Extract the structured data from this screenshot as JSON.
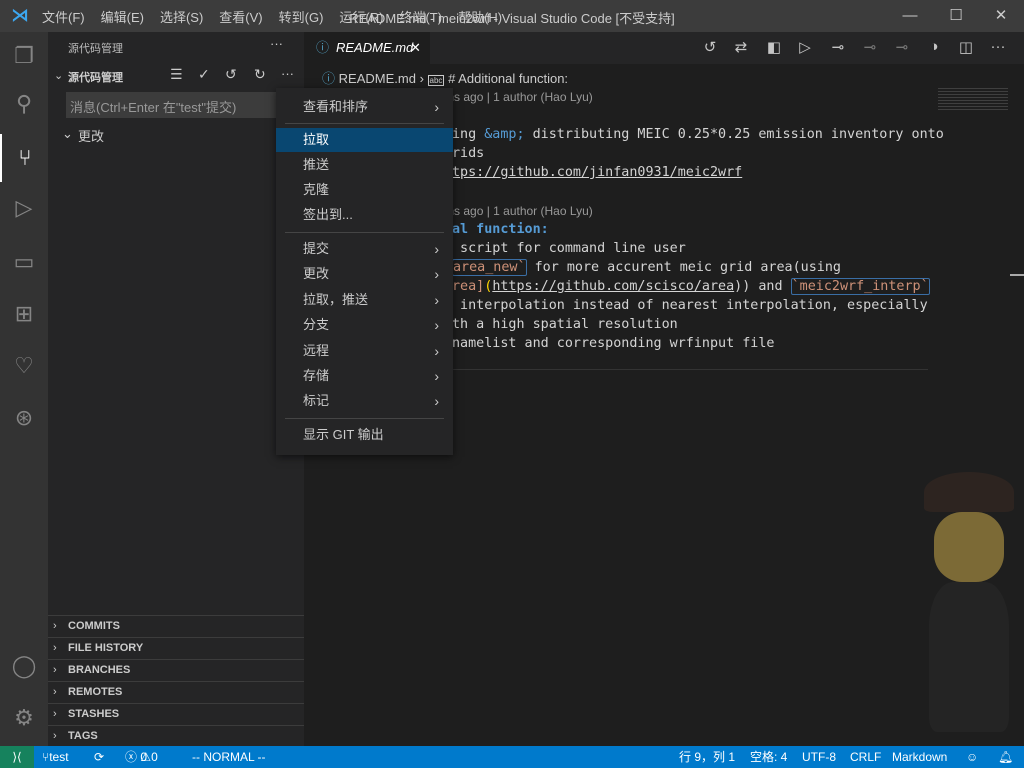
{
  "titlebar": {
    "title": "README.md - meic2wrf - Visual Studio Code [不受支持]",
    "menu": [
      "文件(F)",
      "编辑(E)",
      "选择(S)",
      "查看(V)",
      "转到(G)",
      "运行(R)",
      "终端(T)",
      "帮助(H)"
    ]
  },
  "sidebar": {
    "header": "源代码管理",
    "section_title": "源代码管理",
    "commit_placeholder": "消息(Ctrl+Enter 在\"test\"提交)",
    "changes": "更改",
    "panes": [
      "COMMITS",
      "FILE HISTORY",
      "BRANCHES",
      "REMOTES",
      "STASHES",
      "TAGS"
    ]
  },
  "editor": {
    "tab": "README.md",
    "breadcrumb": {
      "file": "README.md",
      "symbol": "# Additional function:"
    },
    "codelens": [
      "ths ago | 1 author (Hao Lyu)",
      "ths ago | 1 author (Hao Lyu)"
    ],
    "lines": {
      "l1a": "ing ",
      "l1b": "&amp;",
      "l1c": " distributing MEIC 0.25*0.25 emission inventory onto",
      "l2": "rids",
      "l3": "tps://github.com/jinfan0931/meic2wrf",
      "l4": "al function:",
      "l5": " script for command line user",
      "l6a": "area_new`",
      "l6b": " for more accurent meic grid area(using",
      "l7a": "rea]",
      "l7b": "(",
      "l7c": "https://github.com/scisco/area",
      "l7d": ")) and ",
      "l7e": "`meic2wrf_interp`",
      "l8": " interpolation instead of nearest interpolation, especially",
      "l9": "th a high spatial resolution",
      "l10": "namelist and corresponding wrfinput file"
    }
  },
  "context_menu": {
    "items": [
      {
        "label": "查看和排序",
        "submenu": true
      },
      {
        "label": "拉取",
        "selected": true
      },
      {
        "label": "推送"
      },
      {
        "label": "克隆"
      },
      {
        "label": "签出到..."
      },
      {
        "label": "提交",
        "submenu": true
      },
      {
        "label": "更改",
        "submenu": true
      },
      {
        "label": "拉取，推送",
        "submenu": true
      },
      {
        "label": "分支",
        "submenu": true
      },
      {
        "label": "远程",
        "submenu": true
      },
      {
        "label": "存储",
        "submenu": true
      },
      {
        "label": "标记",
        "submenu": true
      },
      {
        "label": "显示 GIT 输出"
      }
    ]
  },
  "statusbar": {
    "branch": "test",
    "errors": "0",
    "warnings": "0",
    "mode": "-- NORMAL --",
    "position": "行 9，列 1",
    "indent": "空格: 4",
    "encoding": "UTF-8",
    "eol": "CRLF",
    "language": "Markdown"
  },
  "colors": {
    "accent": "#007acc",
    "selection": "#094771",
    "remote": "#16825d"
  }
}
